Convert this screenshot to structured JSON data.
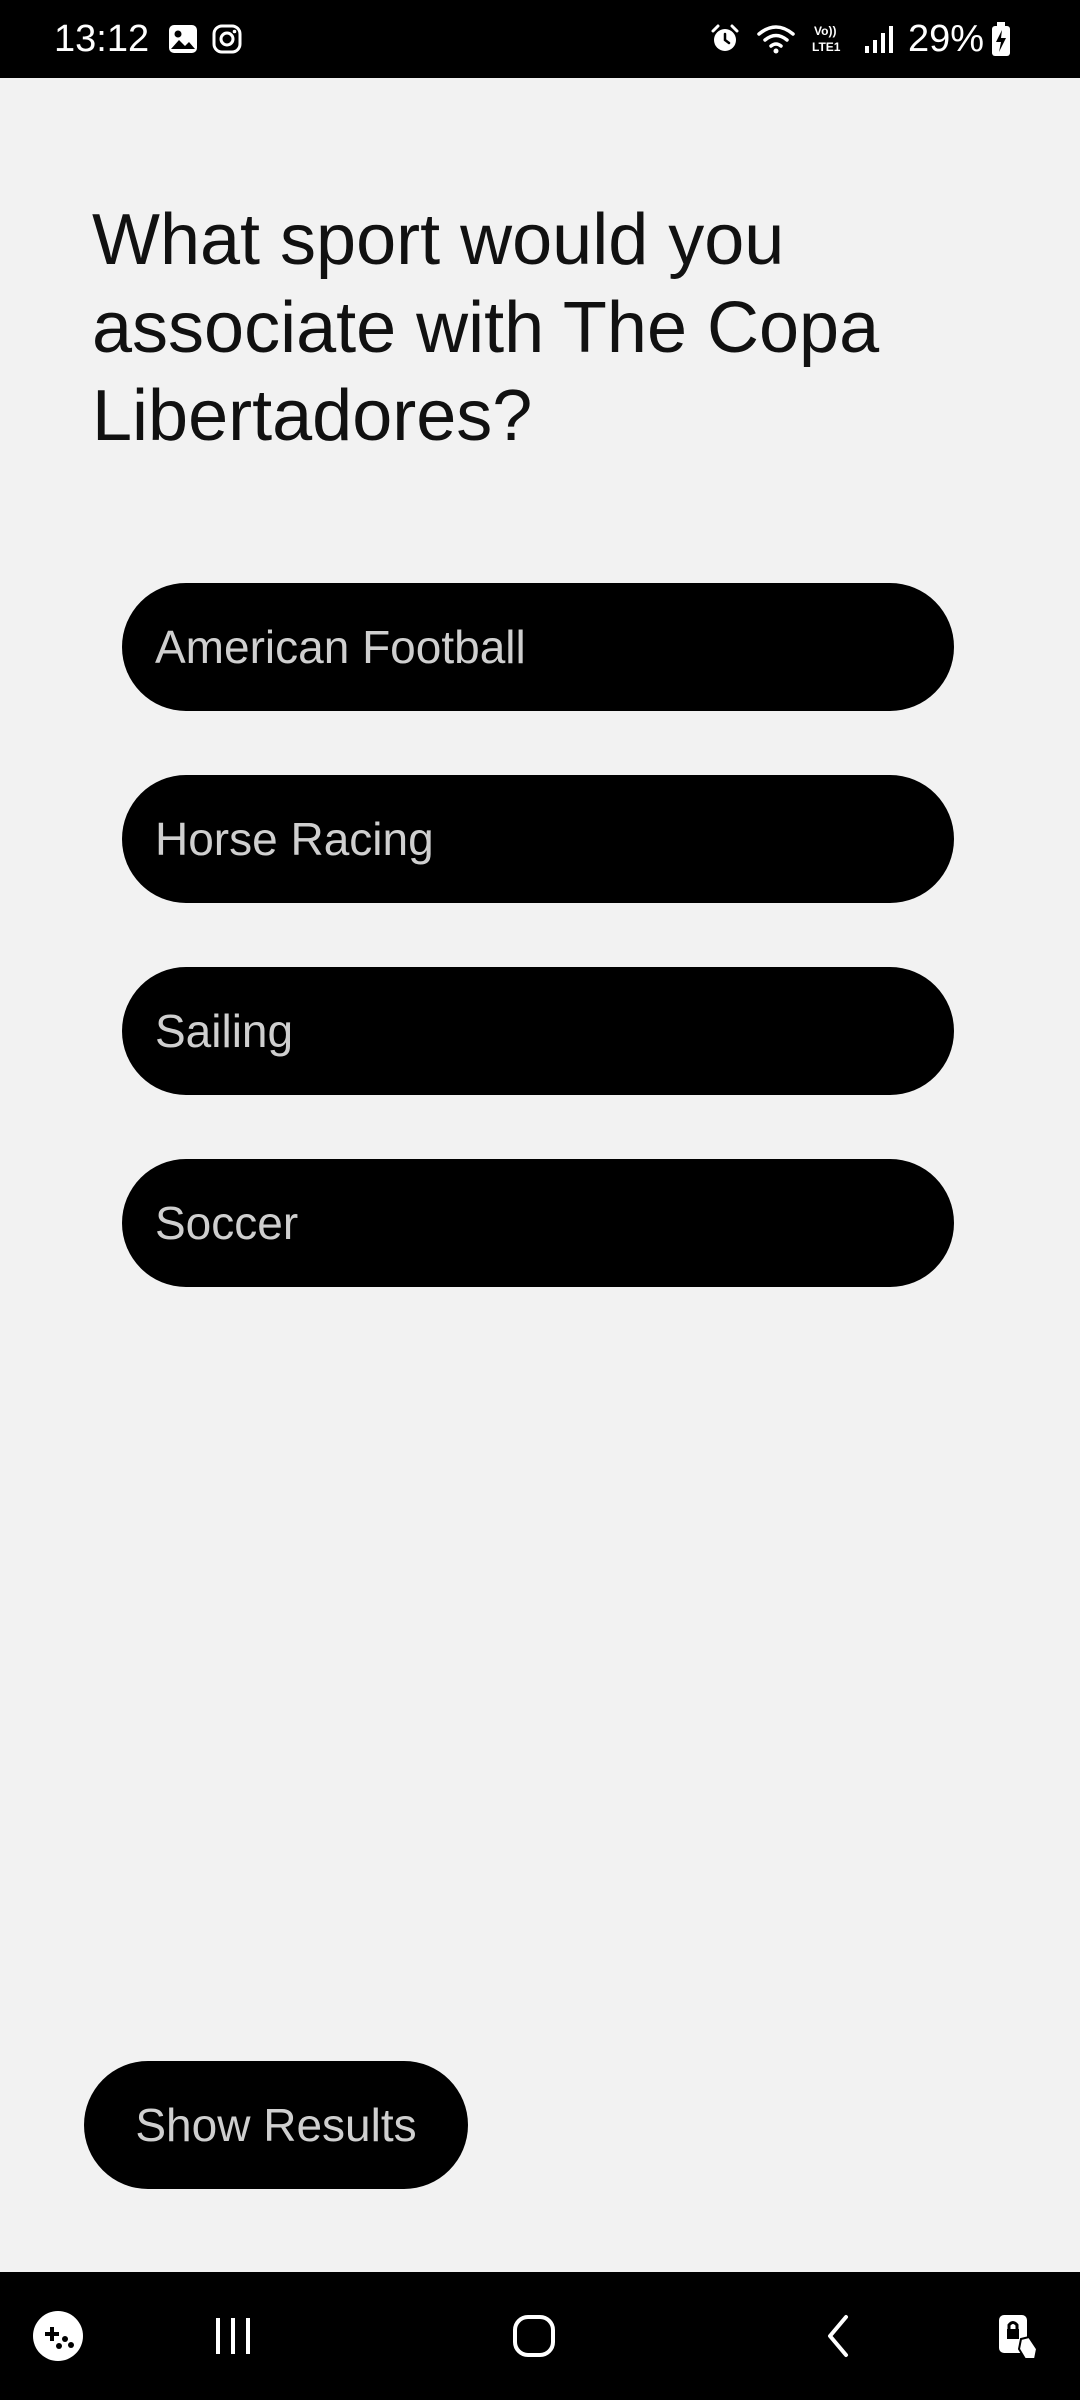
{
  "status_bar": {
    "time": "13:12",
    "battery": "29%",
    "left_icons": [
      "gallery-icon",
      "instagram-icon"
    ],
    "right_icons": [
      "alarm-icon",
      "wifi-icon",
      "volte-icon",
      "signal-icon",
      "battery-charging-icon"
    ],
    "volte_label": "Vo))\nLTE1"
  },
  "quiz": {
    "question": "What sport would you associate with The Copa Libertadores?",
    "options": [
      {
        "label": "American Football"
      },
      {
        "label": "Horse Racing"
      },
      {
        "label": "Sailing"
      },
      {
        "label": "Soccer"
      }
    ],
    "show_results_label": "Show Results"
  },
  "nav_bar": {
    "items": [
      "game-launcher-icon",
      "recent-apps-icon",
      "home-icon",
      "back-icon",
      "screen-lock-icon"
    ]
  },
  "colors": {
    "background": "#f2f2f2",
    "button_bg": "#000000",
    "button_text": "#cfcfcf",
    "question_text": "#111111",
    "bar_bg": "#000000"
  }
}
